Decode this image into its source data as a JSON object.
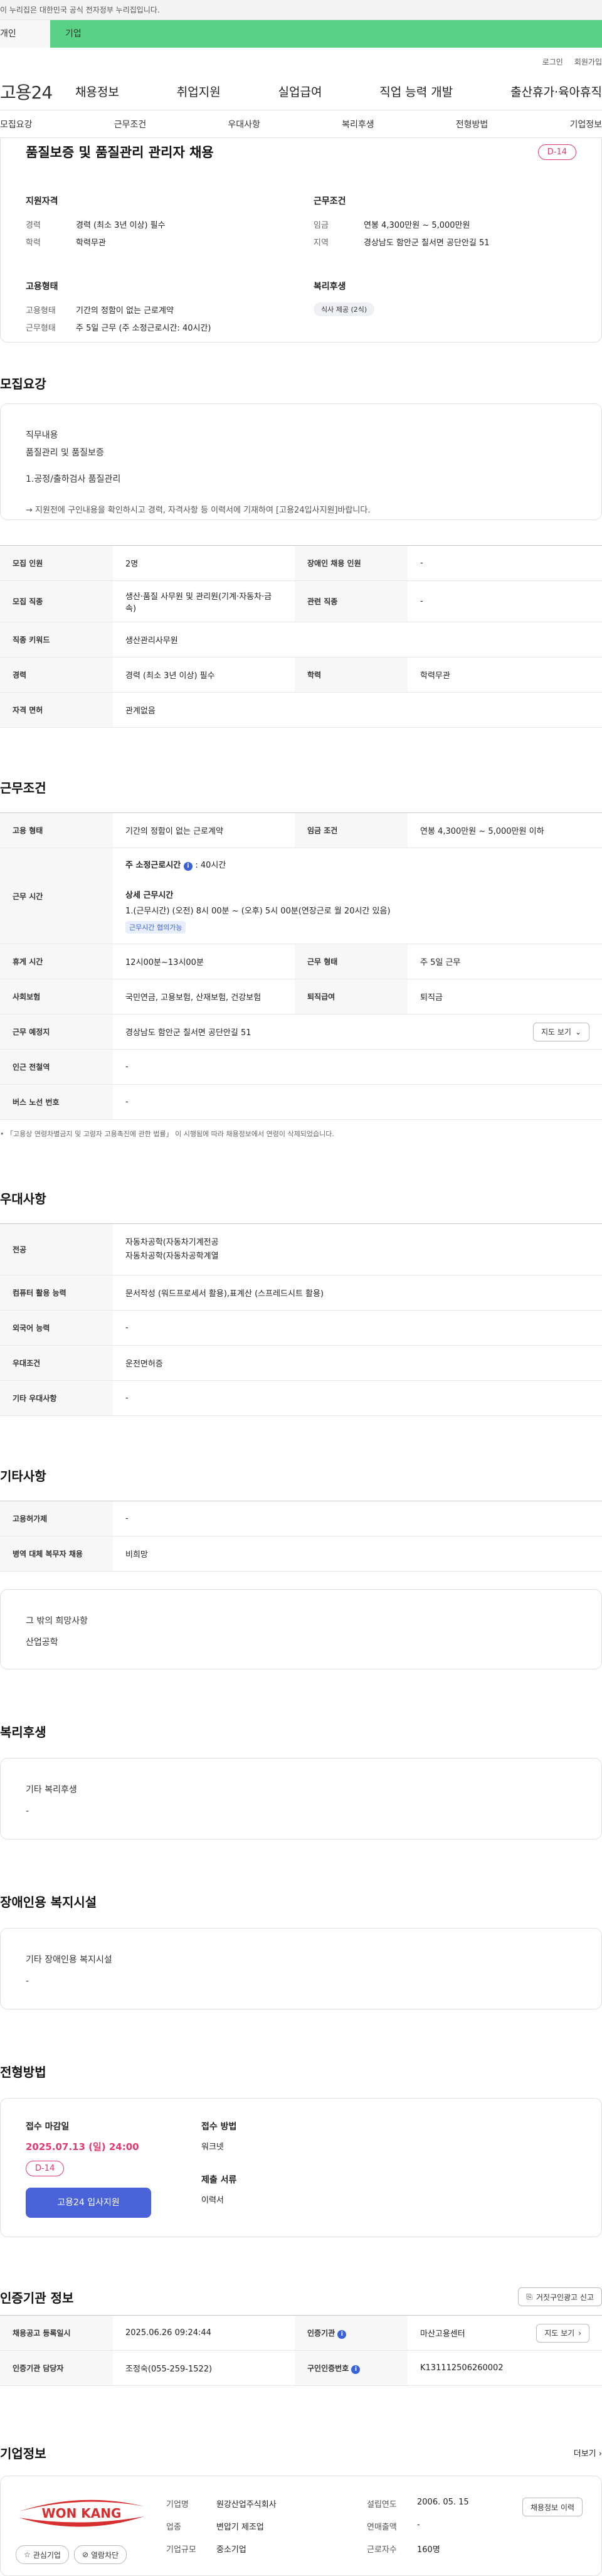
{
  "banner": {
    "text": "이 누리집은 대한민국 공식 전자정부 누리집입니다."
  },
  "topTabs": {
    "personal": "개인",
    "company": "기업"
  },
  "util": {
    "login": "로그인",
    "join": "회원가입"
  },
  "gnb": {
    "logo": "고용24",
    "items": [
      "채용정보",
      "취업지원",
      "실업급여",
      "직업 능력 개발",
      "출산휴가·육아휴직"
    ]
  },
  "subnav": [
    "모집요강",
    "근무조건",
    "우대사항",
    "복리후생",
    "전형방법",
    "기업정보"
  ],
  "summary": {
    "title": "품질보증 및 품질관리 관리자 채용",
    "dday": "D-14",
    "qual": {
      "heading": "지원자격",
      "career_k": "경력",
      "career_v": "경력 (최소 3년 이상) 필수",
      "edu_k": "학력",
      "edu_v": "학력무관"
    },
    "work": {
      "heading": "근무조건",
      "wage_k": "임금",
      "wage_v": "연봉 4,300만원 ~ 5,000만원",
      "region_k": "지역",
      "region_v": "경상남도 함안군 칠서면 공단안길 51"
    },
    "emp": {
      "heading": "고용형태",
      "type_k": "고용형태",
      "type_v": "기간의 정함이 없는 근로계약",
      "hours_k": "근무형태",
      "hours_v": "주 5일 근무 (주 소정근로시간: 40시간)"
    },
    "welfare": {
      "heading": "복리후생",
      "chip": "식사 제공 (2식)"
    }
  },
  "recruit": {
    "title": "모집요강",
    "duty_label": "직무내용",
    "duty_line1": "품질관리 및 품질보증",
    "duty_line2": "1.공정/출하검사 품질관리",
    "duty_note": "→ 지원전에 구인내용을 확인하시고 경력, 자격사항 등 이력서에 기재하여 [고용24입사지원]바랍니다.",
    "rows": [
      {
        "k1": "모집 인원",
        "v1": "2명",
        "k2": "장애인 채용 인원",
        "v2": "-"
      },
      {
        "k1": "모집 직종",
        "v1": "생산·품질 사무원 및 관리원(기계·자동차·금속)",
        "k2": "관련 직종",
        "v2": "-"
      },
      {
        "k1": "직종 키워드",
        "v1": "생산관리사무원"
      },
      {
        "k1": "경력",
        "v1": "경력 (최소 3년 이상) 필수",
        "k2": "학력",
        "v2": "학력무관"
      },
      {
        "k1": "자격 면허",
        "v1": "관계없음"
      }
    ]
  },
  "work": {
    "title": "근무조건",
    "type_k": "고용 형태",
    "type_v": "기간의 정함이 없는 근로계약",
    "wage_k": "임금 조건",
    "wage_v": "연봉 4,300만원 ~ 5,000만원 이하",
    "time_k": "근무 시간",
    "weekly_label": "주 소정근로시간",
    "weekly_value": ": 40시간",
    "detail_label": "상세 근무시간",
    "detail_value": "1.(근무시간) (오전) 8시 00분 ~ (오후) 5시 00분(연장근로 월 20시간 있음)",
    "detail_badge": "근무시간 협의가능",
    "rest_k": "휴게 시간",
    "rest_v": "12시00분~13시00분",
    "form_k": "근무 형태",
    "form_v": "주 5일 근무",
    "ins_k": "사회보험",
    "ins_v": "국민연금, 고용보험, 산재보험, 건강보험",
    "sev_k": "퇴직급여",
    "sev_v": "퇴직금",
    "place_k": "근무 예정지",
    "place_v": "경상남도 함안군 칠서면 공단안길 51",
    "map_btn": "지도 보기",
    "station_k": "인근 전철역",
    "station_v": "-",
    "bus_k": "버스 노선 번호",
    "bus_v": "-",
    "note": "「고용상 연령차별금지 및 고령자 고용촉진에 관한 법률」 이 시행됨에 따라 채용정보에서 연령이 삭제되었습니다."
  },
  "pref": {
    "title": "우대사항",
    "major_k": "전공",
    "major_v1": "자동차공학(자동차기계전공",
    "major_v2": "자동차공학(자동차공학계열",
    "pc_k": "컴퓨터 활용 능력",
    "pc_v": "문서작성 (워드프로세서 활용),표계산 (스프레드시트 활용)",
    "lang_k": "외국어 능력",
    "lang_v": "-",
    "cond_k": "우대조건",
    "cond_v": "운전면허증",
    "etc_k": "기타 우대사항",
    "etc_v": "-"
  },
  "other": {
    "title": "기타사항",
    "sub_k": "고용허가제",
    "sub_v": "-",
    "mil_k": "병역 대체 복무자 채용",
    "mil_v": "비희망",
    "wish_label": "그 밖의 희망사항",
    "wish_value": "산업공학"
  },
  "welfare": {
    "title": "복리후생",
    "label": "기타 복리후생",
    "value": "-"
  },
  "disabled": {
    "title": "장애인용 복지시설",
    "label": "기타 장애인용 복지시설",
    "value": "-"
  },
  "process": {
    "title": "전형방법",
    "deadline_label": "접수 마감일",
    "deadline_value": "2025.07.13 (일) 24:00",
    "dday": "D-14",
    "apply_btn": "고용24 입사지원",
    "method_label": "접수 방법",
    "method_value": "워크넷",
    "docs_label": "제출 서류",
    "docs_value": "이력서"
  },
  "cert": {
    "title": "인증기관 정보",
    "report_btn": "거짓구인광고 신고",
    "reg_k": "채용공고 등록일시",
    "reg_v": "2025.06.26 09:24:44",
    "org_k": "인증기관",
    "org_v": "마산고용센터",
    "map_btn": "지도 보기",
    "mgr_k": "인증기관 담당자",
    "mgr_v": "조정숙(055-259-1522)",
    "num_k": "구인인증번호",
    "num_v": "K131112506260002"
  },
  "company": {
    "title": "기업정보",
    "more": "더보기",
    "logo_text": "WON KANG",
    "name_k": "기업명",
    "name_v": "원강산업주식회사",
    "est_k": "설립연도",
    "est_v": "2006. 05. 15",
    "ind_k": "업종",
    "ind_v": "변압기 제조업",
    "sales_k": "연매출액",
    "sales_v": "-",
    "size_k": "기업규모",
    "size_v": "중소기업",
    "emp_k": "근로자수",
    "emp_v": "160명",
    "history_btn": "채용정보 이력",
    "fav_btn": "관심기업",
    "block_btn": "열람차단"
  }
}
